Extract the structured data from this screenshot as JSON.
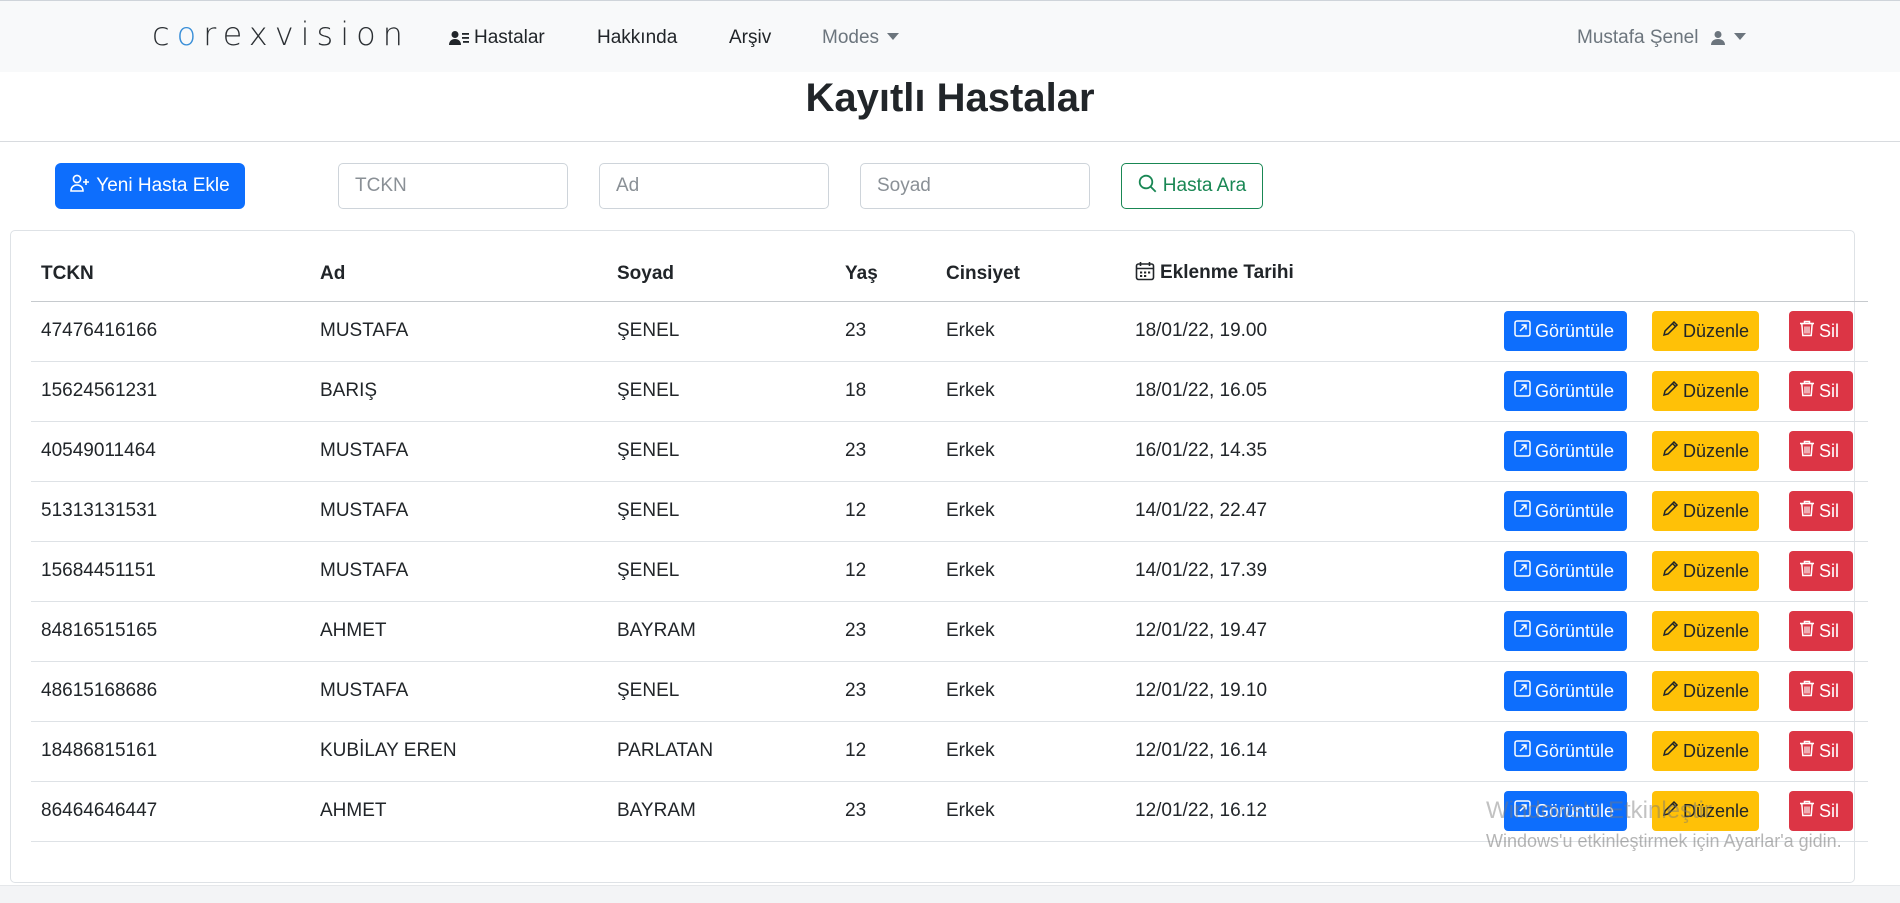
{
  "navbar": {
    "brand": "corexvision",
    "links": [
      {
        "label": "Hastalar",
        "icon": "patient-list-icon"
      },
      {
        "label": "Hakkında"
      },
      {
        "label": "Arşiv"
      },
      {
        "label": "Modes",
        "icon": "chevron-down-icon"
      }
    ],
    "user": {
      "name": "Mustafa Şenel",
      "icon": "user-icon"
    }
  },
  "page": {
    "title": "Kayıtlı Hastalar"
  },
  "toolbar": {
    "add_button": "Yeni Hasta Ekle",
    "tckn_placeholder": "TCKN",
    "ad_placeholder": "Ad",
    "soyad_placeholder": "Soyad",
    "search_button": "Hasta Ara"
  },
  "table": {
    "headers": {
      "tckn": "TCKN",
      "ad": "Ad",
      "soyad": "Soyad",
      "yas": "Yaş",
      "cinsiyet": "Cinsiyet",
      "tarih": "Eklenme Tarihi"
    },
    "actions": {
      "view": "Görüntüle",
      "edit": "Düzenle",
      "delete": "Sil"
    },
    "rows": [
      {
        "tckn": "47476416166",
        "ad": "MUSTAFA",
        "soyad": "ŞENEL",
        "yas": "23",
        "cinsiyet": "Erkek",
        "tarih": "18/01/22, 19.00"
      },
      {
        "tckn": "15624561231",
        "ad": "BARIŞ",
        "soyad": "ŞENEL",
        "yas": "18",
        "cinsiyet": "Erkek",
        "tarih": "18/01/22, 16.05"
      },
      {
        "tckn": "40549011464",
        "ad": "MUSTAFA",
        "soyad": "ŞENEL",
        "yas": "23",
        "cinsiyet": "Erkek",
        "tarih": "16/01/22, 14.35"
      },
      {
        "tckn": "51313131531",
        "ad": "MUSTAFA",
        "soyad": "ŞENEL",
        "yas": "12",
        "cinsiyet": "Erkek",
        "tarih": "14/01/22, 22.47"
      },
      {
        "tckn": "15684451151",
        "ad": "MUSTAFA",
        "soyad": "ŞENEL",
        "yas": "12",
        "cinsiyet": "Erkek",
        "tarih": "14/01/22, 17.39"
      },
      {
        "tckn": "84816515165",
        "ad": "AHMET",
        "soyad": "BAYRAM",
        "yas": "23",
        "cinsiyet": "Erkek",
        "tarih": "12/01/22, 19.47"
      },
      {
        "tckn": "48615168686",
        "ad": "MUSTAFA",
        "soyad": "ŞENEL",
        "yas": "23",
        "cinsiyet": "Erkek",
        "tarih": "12/01/22, 19.10"
      },
      {
        "tckn": "18486815161",
        "ad": "KUBİLAY EREN",
        "soyad": "PARLATAN",
        "yas": "12",
        "cinsiyet": "Erkek",
        "tarih": "12/01/22, 16.14"
      },
      {
        "tckn": "86464646447",
        "ad": "AHMET",
        "soyad": "BAYRAM",
        "yas": "23",
        "cinsiyet": "Erkek",
        "tarih": "12/01/22, 16.12"
      }
    ]
  },
  "watermark": {
    "line1": "Windows'u Etkinleştir",
    "line2": "Windows'u etkinleştirmek için Ayarlar'a gidin."
  },
  "colors": {
    "primary": "#0d6efd",
    "warning": "#ffc107",
    "danger": "#dc3545",
    "success": "#198754",
    "navbar_bg": "#f8f9fa"
  }
}
